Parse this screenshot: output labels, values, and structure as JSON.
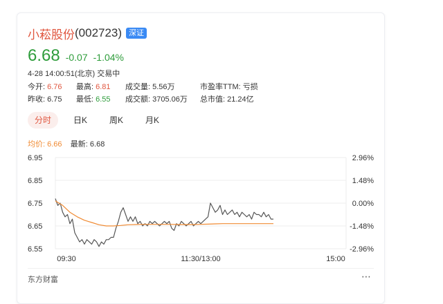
{
  "stock": {
    "name": "小菘股份",
    "code": "(002723)",
    "market": "深证",
    "price": "6.68",
    "change": "-0.07",
    "change_pct": "-1.04%",
    "timestamp": "4-28 14:00:51(北京) 交易中"
  },
  "stats": {
    "open_label": "今开:",
    "open": "6.76",
    "high_label": "最高:",
    "high": "6.81",
    "volume_label": "成交量:",
    "volume": "5.56万",
    "pe_label": "市盈率TTM:",
    "pe": "亏损",
    "prev_close_label": "昨收:",
    "prev_close": "6.75",
    "low_label": "最低:",
    "low": "6.55",
    "turnover_label": "成交额:",
    "turnover": "3705.06万",
    "mcap_label": "总市值:",
    "mcap": "21.24亿"
  },
  "tabs": [
    "分时",
    "日K",
    "周K",
    "月K"
  ],
  "active_tab": 0,
  "legend": {
    "avg_label": "均价:",
    "avg": "6.66",
    "latest_label": "最新:",
    "latest": "6.68"
  },
  "colors": {
    "up": "#e0563f",
    "down": "#2e9c3b",
    "price_line": "#555555",
    "avg_line": "#f08a32",
    "badge": "#3a8af4"
  },
  "footer": {
    "source": "东方财富",
    "more_icon": "more-icon"
  },
  "chart_data": {
    "type": "line",
    "x_ticks": [
      "09:30",
      "11:30/13:00",
      "15:00"
    ],
    "y_left_ticks": [
      "6.95",
      "6.85",
      "6.75",
      "6.65",
      "6.55"
    ],
    "y_right_ticks": [
      "2.96%",
      "1.48%",
      "0.00%",
      "-1.48%",
      "-2.96%"
    ],
    "ylim": [
      6.55,
      6.95
    ],
    "x_minutes_range": [
      0,
      240
    ],
    "series": [
      {
        "x": [
          0,
          2,
          4,
          6,
          8,
          10,
          12,
          14,
          16,
          18,
          20,
          22,
          24,
          26,
          28,
          30,
          32,
          34,
          36,
          38,
          40,
          42,
          44,
          46,
          48,
          50,
          52,
          54,
          56,
          58,
          60,
          62,
          64,
          66,
          68,
          70,
          72,
          74,
          76,
          78,
          80,
          82,
          84,
          86,
          88,
          90,
          92,
          94,
          96,
          98,
          100,
          102,
          104,
          106,
          108,
          110,
          112,
          114,
          116,
          118,
          120,
          122,
          124,
          126,
          128,
          130,
          132,
          134,
          136,
          138,
          140,
          142,
          144,
          146,
          148,
          150,
          152,
          154,
          156,
          158,
          160,
          162,
          164,
          166,
          168,
          170,
          172,
          174,
          176,
          178,
          180
        ],
        "values": [
          6.77,
          6.74,
          6.75,
          6.71,
          6.69,
          6.7,
          6.66,
          6.68,
          6.62,
          6.6,
          6.58,
          6.59,
          6.57,
          6.59,
          6.58,
          6.57,
          6.59,
          6.58,
          6.56,
          6.58,
          6.57,
          6.59,
          6.59,
          6.6,
          6.6,
          6.64,
          6.67,
          6.71,
          6.73,
          6.7,
          6.67,
          6.69,
          6.67,
          6.69,
          6.66,
          6.67,
          6.65,
          6.66,
          6.65,
          6.67,
          6.66,
          6.67,
          6.66,
          6.65,
          6.66,
          6.67,
          6.66,
          6.67,
          6.64,
          6.63,
          6.66,
          6.65,
          6.67,
          6.66,
          6.65,
          6.66,
          6.67,
          6.65,
          6.66,
          6.67,
          6.66,
          6.67,
          6.68,
          6.69,
          6.75,
          6.73,
          6.71,
          6.72,
          6.74,
          6.7,
          6.72,
          6.7,
          6.71,
          6.72,
          6.7,
          6.71,
          6.69,
          6.71,
          6.7,
          6.69,
          6.7,
          6.68,
          6.71,
          6.7,
          6.7,
          6.69,
          6.71,
          6.69,
          6.7,
          6.68,
          6.68
        ]
      },
      {
        "x": [
          0,
          6,
          12,
          18,
          24,
          30,
          36,
          42,
          48,
          54,
          60,
          66,
          72,
          78,
          84,
          90,
          96,
          102,
          108,
          114,
          120,
          126,
          132,
          138,
          144,
          150,
          156,
          162,
          168,
          174,
          180
        ],
        "values": [
          6.76,
          6.74,
          6.71,
          6.69,
          6.675,
          6.665,
          6.655,
          6.65,
          6.65,
          6.652,
          6.655,
          6.656,
          6.657,
          6.657,
          6.657,
          6.657,
          6.657,
          6.656,
          6.656,
          6.656,
          6.657,
          6.658,
          6.659,
          6.66,
          6.66,
          6.66,
          6.66,
          6.66,
          6.66,
          6.66,
          6.66
        ]
      }
    ],
    "grid": true
  }
}
